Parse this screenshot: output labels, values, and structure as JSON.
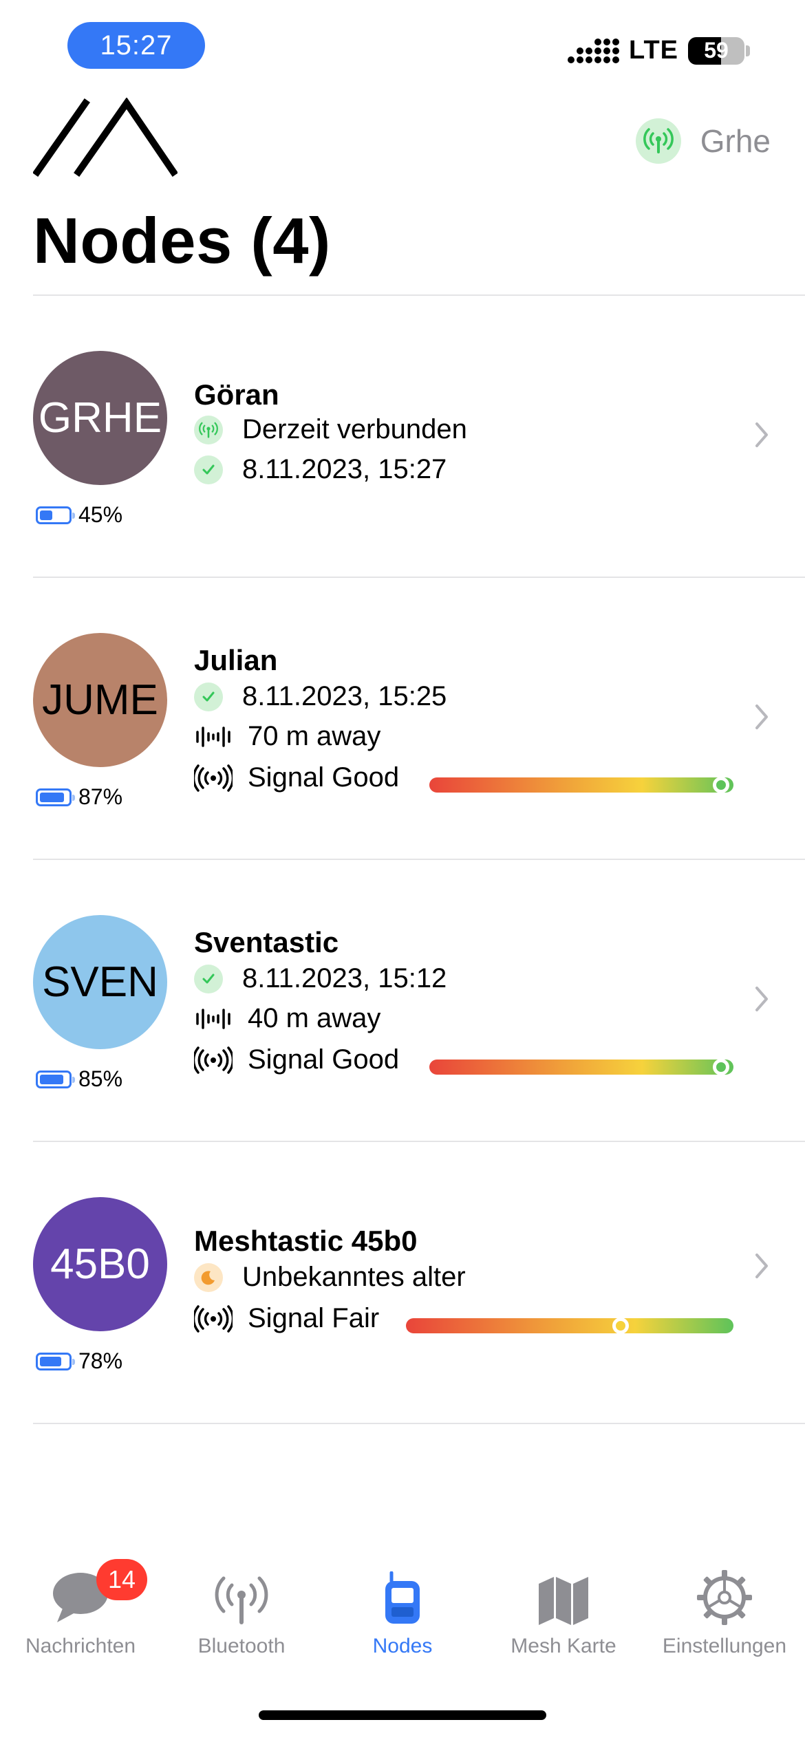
{
  "status_bar": {
    "time": "15:27",
    "network": "LTE",
    "battery": "59"
  },
  "header": {
    "connected_node": "Grhe",
    "title": "Nodes (4)"
  },
  "nodes": [
    {
      "short": "GRHE",
      "name": "Göran",
      "avatar_color": "#6e5a66",
      "avatar_text_color": "#ffffff",
      "battery": "45%",
      "battery_level": 0.45,
      "line1": "Derzeit verbunden",
      "line1_icon": "antenna-icon",
      "line2": "8.11.2023, 15:27",
      "line2_icon": "checkmark-icon"
    },
    {
      "short": "JUME",
      "name": "Julian",
      "avatar_color": "#b8836a",
      "avatar_text_color": "#000000",
      "battery": "87%",
      "battery_level": 0.87,
      "line1": "8.11.2023, 15:25",
      "line1_icon": "checkmark-icon",
      "line2": "70 m away",
      "line2_icon": "distance-icon",
      "signal": "Signal Good",
      "signal_level": "good"
    },
    {
      "short": "SVEN",
      "name": "Sventastic",
      "avatar_color": "#8ec6ec",
      "avatar_text_color": "#000000",
      "battery": "85%",
      "battery_level": 0.85,
      "line1": "8.11.2023, 15:12",
      "line1_icon": "checkmark-icon",
      "line2": "40 m away",
      "line2_icon": "distance-icon",
      "signal": "Signal Good",
      "signal_level": "good"
    },
    {
      "short": "45B0",
      "name": "Meshtastic 45b0",
      "avatar_color": "#6444ab",
      "avatar_text_color": "#ffffff",
      "battery": "78%",
      "battery_level": 0.78,
      "line1": "Unbekanntes alter",
      "line1_icon": "moon-icon",
      "signal": "Signal Fair",
      "signal_level": "fair"
    }
  ],
  "tabs": [
    {
      "label": "Nachrichten",
      "icon": "chat-bubble-icon",
      "badge": "14",
      "active": false
    },
    {
      "label": "Bluetooth",
      "icon": "antenna-icon",
      "active": false
    },
    {
      "label": "Nodes",
      "icon": "radio-device-icon",
      "active": true
    },
    {
      "label": "Mesh Karte",
      "icon": "map-icon",
      "active": false
    },
    {
      "label": "Einstellungen",
      "icon": "gear-icon",
      "active": false
    }
  ],
  "colors": {
    "accent": "#3478f6",
    "signal_good": "#5ec35a",
    "signal_fair": "#f6d23c",
    "badge": "#ff3b30"
  }
}
